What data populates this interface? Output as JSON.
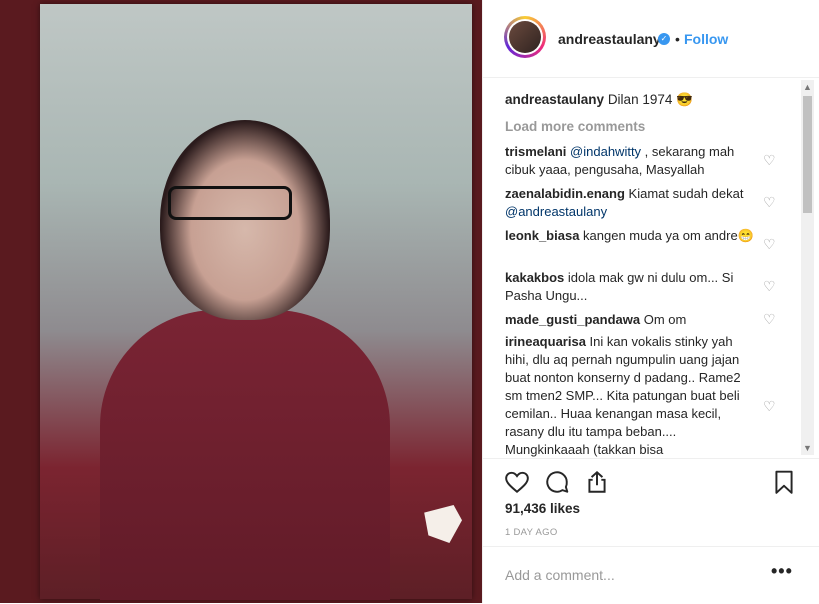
{
  "post": {
    "username": "andreastaulany",
    "verified_icon": "verified-badge-icon",
    "dot": "•",
    "follow_label": "Follow",
    "caption_user": "andreastaulany",
    "caption_text": "Dilan 1974 😎",
    "load_more": "Load more comments",
    "comments": [
      {
        "user": "trismelani",
        "mention": "@indahwitty",
        "text": " , sekarang mah cibuk yaaa, pengusaha, Masyallah"
      },
      {
        "user": "zaenalabidin.enang",
        "text": " Kiamat sudah dekat ",
        "mention": "@andreastaulany"
      },
      {
        "user": "leonk_biasa",
        "text": " kangen muda ya om andre😁"
      },
      {
        "user": "kakakbos",
        "text": " idola mak gw ni dulu om... Si Pasha Ungu..."
      },
      {
        "user": "made_gusti_pandawa",
        "text": " Om om"
      },
      {
        "user": "irineaquarisa",
        "text": " Ini kan vokalis stinky yah hihi, dlu aq pernah ngumpulin uang jajan buat nonton konserny d padang.. Rame2 sm tmen2 SMP... Kita patungan buat beli cemilan.. Huaa kenangan masa kecil, rasany dlu itu tampa beban.... Mungkinkaaah (takkan bisa"
      }
    ],
    "likes": "91,436 likes",
    "time_ago": "1 DAY AGO",
    "add_comment_placeholder": "Add a comment...",
    "more_options": "•••"
  },
  "icons": {
    "like": "heart-icon",
    "comment": "comment-icon",
    "share": "share-icon",
    "save": "bookmark-icon"
  },
  "colors": {
    "accent": "#3897f0",
    "text": "#262626",
    "muted": "#999999"
  }
}
